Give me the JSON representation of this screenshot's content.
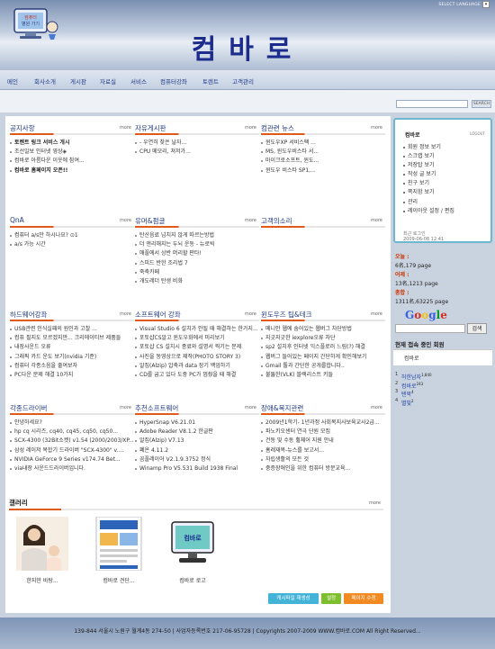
{
  "header": {
    "title": "컴바로",
    "language_label": "SELECT LANGUAGE",
    "logo_alt": "컴퓨터 병원 가기"
  },
  "nav": {
    "items": [
      "메인",
      "회사소개",
      "게시판",
      "자료실",
      "서비스",
      "컴퓨터강좌",
      "토렌트",
      "고객관리"
    ]
  },
  "search": {
    "placeholder": "",
    "button_label": "SEARCH"
  },
  "sections": [
    {
      "title": "공지사항",
      "more": "more",
      "items": [
        "토렌트 링크 서비스 개시",
        "조선일보 인터넷 영상◈",
        "컴바로 아름다운 이웃에 참여...",
        "컴바로 홈페이지 오픈!!"
      ],
      "bold": [
        0,
        3
      ]
    },
    {
      "title": "자유게시판",
      "more": "more",
      "items": [
        "- 우연히 찾은 날자...",
        "CPU 메모리, 쳐저가..."
      ],
      "bold": []
    },
    {
      "title": "컴관련 뉴스",
      "more": "more",
      "items": [
        "윈도우XP 서비스팩 ...",
        "MS, 윈도우비스타 서...",
        "마이크로소프트, 윈도...",
        "윈도우 비스타 SP1,..."
      ],
      "bold": []
    },
    {
      "title": "QnA",
      "more": "more",
      "items": [
        "컴퓨터 a/s만 하시나요? ⊙1",
        "a/s 가능 시간"
      ],
      "bold": []
    },
    {
      "title": "유머&펌글",
      "more": "more",
      "items": [
        "탄산음료 넘치지 않게 따르는방법",
        "더 앤리해지는 두뇌 운동 - 뉴로빅",
        "애플에서 상반 머리할 판타!",
        "스피드 반한 조리법 7",
        "죽축카페",
        "개도레더 탄생 비화"
      ],
      "bold": []
    },
    {
      "title": "고객의소리",
      "more": "more",
      "items": [],
      "bold": []
    },
    {
      "title": "하드웨어강좌",
      "more": "more",
      "items": [
        "USB관련 인식실패의 원인과 고찰 ...",
        "컴퓨 필지도 모르겠지만... 크리에이티브 제품들",
        "내장사운드 오류",
        "그래픽 카드 운도 보기(nvidia 기준)",
        "컴퓨터 각종소음을 줄여보자",
        "PC다운 문제 해결 10가지"
      ],
      "bold": []
    },
    {
      "title": "소프트웨어 강좌",
      "more": "more",
      "items": [
        "Visual Studio 6 설치가 안될 때 해결하는 한가지...",
        "포토샵CS알고 윈도우화에서 미리보기",
        "포토샵 CS 설치시 종료와 설명서 찍기는 문제",
        "사진을 동영상으로 제작(PHOTO STORY 3)",
        "알집(Alzip) 압축과 data 장기 백업하기",
        "CD를 굽고 있다 도중 PC가 멈췄을 때 해결"
      ],
      "bold": []
    },
    {
      "title": "윈도우즈 팁&테크",
      "more": "more",
      "items": [
        "메니안 웹에 숨어있는 웹버그 차단방법",
        "지긋지긋한 iexplore오류 차단",
        "sp2 설치후 인터넷 익스플로러 느림(?) 해결",
        "웹버그 들어있는 페이지 간단하게 확인해보기",
        "Gmail 톨과 간단한 공개를합니다..",
        "불뚫한(VLK) 블랙리스트 키들"
      ],
      "bold": []
    },
    {
      "title": "각종드라이버",
      "more": "more",
      "items": [
        "안녕하세요?",
        "hp cq 시리즈, cq40, cq45, cq50, cq50...",
        "SCX-4300 (32Bit소켓) v1.54 (2000/2003/XP...",
        "삼성 레이저 복합기 드라이버 \"SCX-4300\" v....",
        "NVIDIA GeForce 9 Series v174.74 Bet...",
        "via내장 사운드드라이버입니다."
      ],
      "bold": []
    },
    {
      "title": "추천소프트웨어",
      "more": "more",
      "items": [
        "HyperSnap V6.21.01",
        "Adobe Reader V8.1.2 한글판",
        "알집(Alzip) V7.13",
        "폐온 4.11.2",
        "곰플레이어 V2.1.9.3752 정식",
        "Winamp Pro V5.531 Build 1938 Final"
      ],
      "bold": []
    },
    {
      "title": "장애&복지관련",
      "more": "more",
      "items": [
        "2009년1학기- 1년과정 사회복지사보육교사2급...",
        "파노키오센터 연극 단원 모집",
        "건동 및 수동 휠체어 지원 안내",
        "홈레재복-뉴스를 보고서...",
        "자립생활의 모든 것",
        "중증장애인을 위한 컴퓨터 방문교육..."
      ],
      "bold": []
    }
  ],
  "gallery": {
    "title": "갤러리",
    "more": "more",
    "items": [
      "한지만 바탕...",
      "컴바로 견단...",
      "컴바로 로고"
    ]
  },
  "buttons": {
    "gallery_play": "캐시파일 재생성",
    "setting": "설정",
    "page_edit": "페이지 수정"
  },
  "sidebar": {
    "user": "컴바로",
    "logout": "LOGOUT",
    "menu": [
      "회원 정보 보기",
      "스크랩 보기",
      "저장탑 보기",
      "작성 글 보기",
      "친구 보기",
      "쪽지함 보기",
      "관리",
      "레이아웃 설정 / 편집"
    ],
    "last_login_label": "최근 로그인",
    "last_login": "2009-06-08 12:41"
  },
  "visitors": {
    "today_label": "오늘 :",
    "today": "6名,179 page",
    "yesterday_label": "어제 :",
    "yesterday": "13名,1213 page",
    "total_label": "총합 :",
    "total": "1311名,63225 page"
  },
  "google": {
    "logo": "Google",
    "button": "검색",
    "colors": [
      "#3b5de7",
      "#d62d20",
      "#f4c20d",
      "#3b5de7",
      "#009925",
      "#d62d20"
    ]
  },
  "online": {
    "title": "현재 접속 중인 회원",
    "user": "컴바로",
    "ranks": [
      {
        "n": "1",
        "name": "허한남자",
        "score": "1,840"
      },
      {
        "n": "2",
        "name": "컴바로",
        "score": "243"
      },
      {
        "n": "3",
        "name": "텐북",
        "score": "4"
      },
      {
        "n": "4",
        "name": "별빛",
        "score": "2"
      }
    ]
  },
  "footer": {
    "text": "139-844 서울시 노원구 월계4동 274-50  |  사업자등록번호 217-06-95728  |  Copyrights 2007-2009 WWW.컴바로.COM All Right Reserved..."
  }
}
